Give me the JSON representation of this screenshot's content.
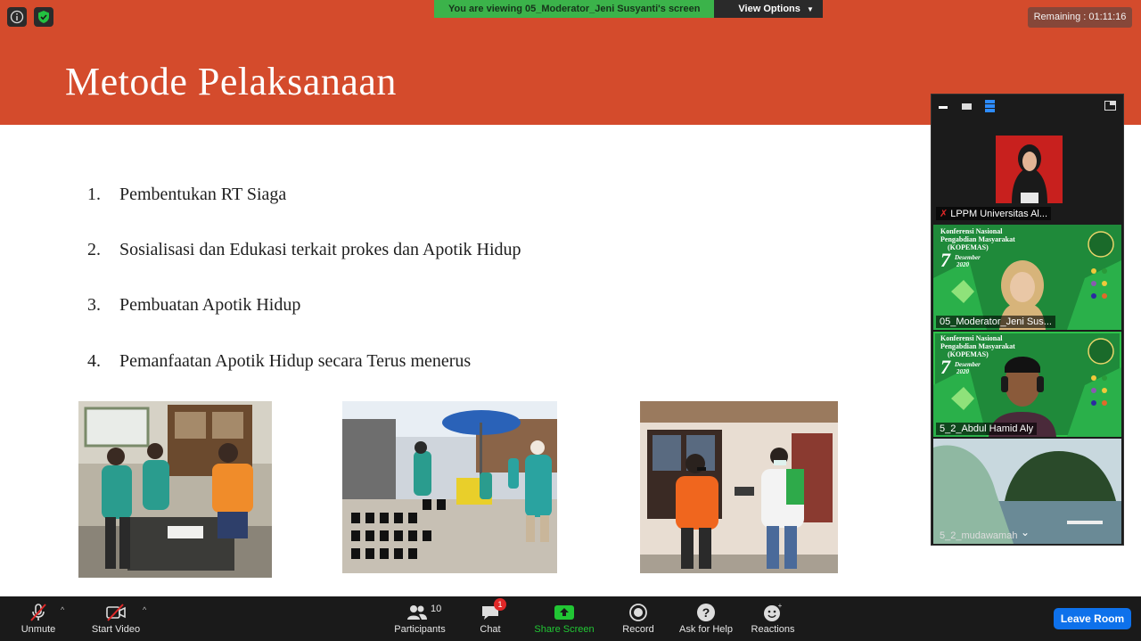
{
  "banner": {
    "viewing_text": "You are viewing 05_Moderator_Jeni Susyanti's screen",
    "view_options": "View Options"
  },
  "remaining": "Remaining : 01:11:16",
  "slide": {
    "title": "Metode Pelaksanaan",
    "items": [
      {
        "num": "1.",
        "text": "Pembentukan RT Siaga"
      },
      {
        "num": "2.",
        "text": "Sosialisasi dan Edukasi terkait prokes dan Apotik Hidup"
      },
      {
        "num": "3.",
        "text": "Pembuatan Apotik Hidup"
      },
      {
        "num": "4.",
        "text": "Pemanfaatan Apotik Hidup secara Terus menerus"
      }
    ]
  },
  "participants_panel": {
    "tiles": [
      {
        "name": "LPPM Universitas Al..."
      },
      {
        "name": "05_Moderator_Jeni Sus..."
      },
      {
        "name": "5_2_Abdul Hamid Aly"
      },
      {
        "name": "5_2_mudawamah"
      }
    ],
    "bg_text": {
      "line1": "Konferensi Nasional",
      "line2": "Pengabdian Masyarakat",
      "line3": "(KOPEMAS)",
      "day": "7",
      "month": "Desember",
      "year": "2020"
    }
  },
  "toolbar": {
    "unmute": "Unmute",
    "start_video": "Start Video",
    "participants": "Participants",
    "participants_count": "10",
    "chat": "Chat",
    "chat_badge": "1",
    "share_screen": "Share Screen",
    "record": "Record",
    "ask_for_help": "Ask for Help",
    "reactions": "Reactions",
    "leave_room": "Leave Room"
  },
  "colors": {
    "title_band": "#d44b2c",
    "banner_green": "#3bb34a",
    "share_green": "#21c634",
    "leave_blue": "#0e71eb",
    "kopemas_green": "#1f8a3a"
  }
}
